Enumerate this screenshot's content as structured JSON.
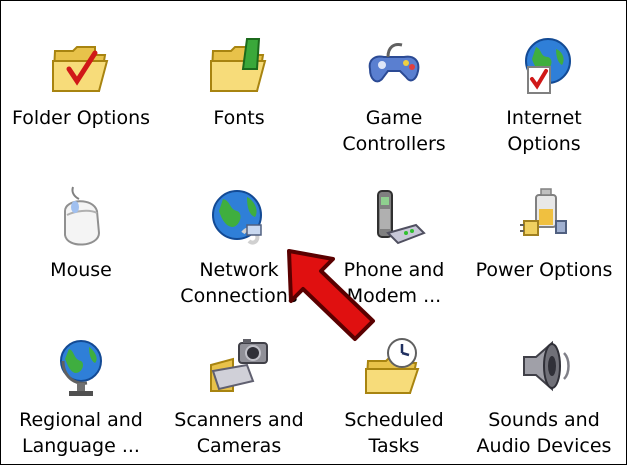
{
  "control_panel": {
    "items": [
      {
        "label": "Folder Options",
        "icon": "folder-options-icon"
      },
      {
        "label": "Fonts",
        "icon": "fonts-folder-icon"
      },
      {
        "label": "Game\nControllers",
        "icon": "game-controller-icon"
      },
      {
        "label": "Internet\nOptions",
        "icon": "internet-options-icon"
      },
      {
        "label": "Mouse",
        "icon": "mouse-icon"
      },
      {
        "label": "Network\nConnections",
        "icon": "network-globe-icon"
      },
      {
        "label": "Phone and\nModem ...",
        "icon": "phone-modem-icon"
      },
      {
        "label": "Power Options",
        "icon": "power-plug-icon"
      },
      {
        "label": "Regional and\nLanguage ...",
        "icon": "globe-icon"
      },
      {
        "label": "Scanners and\nCameras",
        "icon": "scanner-camera-icon"
      },
      {
        "label": "Scheduled\nTasks",
        "icon": "scheduled-tasks-icon"
      },
      {
        "label": "Sounds and\nAudio Devices",
        "icon": "speaker-icon"
      }
    ]
  },
  "annotation": {
    "icon": "red-arrow-icon",
    "color": "#e01010"
  }
}
